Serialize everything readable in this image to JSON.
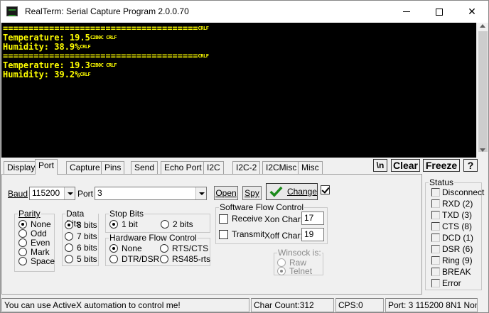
{
  "window": {
    "title": "RealTerm: Serial Capture Program 2.0.0.70",
    "close_glyph": "✕"
  },
  "terminal": {
    "lines": [
      {
        "text": "======================================",
        "ctrl": "CRLF"
      },
      {
        "text": "Temperature: 19.5",
        "ctrl": "C2B0C CRLF"
      },
      {
        "text": "Humidity: 38.9%",
        "ctrl": "CRLF"
      },
      {
        "text": "======================================",
        "ctrl": "CRLF"
      },
      {
        "text": "Temperature: 19.3",
        "ctrl": "C2B0C CRLF"
      },
      {
        "text": "Humidity: 39.2%",
        "ctrl": "CRLF"
      }
    ],
    "text_color": "#ffff00",
    "bg_color": "#000000"
  },
  "tabs": [
    {
      "label": "Display"
    },
    {
      "label": "Port"
    },
    {
      "label": "Capture"
    },
    {
      "label": "Pins"
    },
    {
      "label": "Send"
    },
    {
      "label": "Echo Port"
    },
    {
      "label": "I2C"
    },
    {
      "label": "I2C-2"
    },
    {
      "label": "I2CMisc"
    },
    {
      "label": "Misc"
    }
  ],
  "active_tab": "Port",
  "top_buttons": {
    "newline": "\\n",
    "clear": "Clear",
    "freeze": "Freeze",
    "help": "?"
  },
  "port": {
    "baud_label": "Baud",
    "baud_value": "115200",
    "port_label": "Port",
    "port_value": "3",
    "open_label": "Open",
    "spy_label": "Spy",
    "change_label": "Change",
    "change_checked": true,
    "parity": {
      "label": "Parity",
      "options": [
        "None",
        "Odd",
        "Even",
        "Mark",
        "Space"
      ],
      "selected": "None"
    },
    "data_bits": {
      "label": "Data Bits",
      "options": [
        "8 bits",
        "7 bits",
        "6 bits",
        "5 bits"
      ],
      "selected": "8 bits"
    },
    "stop_bits": {
      "label": "Stop Bits",
      "options": [
        "1 bit",
        "2 bits"
      ],
      "selected": "1 bit"
    },
    "hw_flow": {
      "label": "Hardware Flow Control",
      "options": [
        "None",
        "RTS/CTS",
        "DTR/DSR",
        "RS485-rts"
      ],
      "selected": "None"
    },
    "sw_flow": {
      "label": "Software Flow Control",
      "receive_label": "Receive",
      "transmit_label": "Transmit",
      "xon_label": "Xon Char:",
      "xon_value": "17",
      "xoff_label": "Xoff Char:",
      "xoff_value": "19"
    },
    "winsock": {
      "label": "Winsock is:",
      "options": [
        "Raw",
        "Telnet"
      ],
      "selected": "Telnet"
    }
  },
  "status": {
    "label": "Status",
    "items": [
      "Disconnect",
      "RXD (2)",
      "TXD (3)",
      "CTS (8)",
      "DCD (1)",
      "DSR (6)",
      "Ring (9)",
      "BREAK",
      "Error"
    ]
  },
  "statusbar": {
    "message": "You can use ActiveX automation to control me!",
    "char_count": "Char Count:312",
    "cps": "CPS:0",
    "port_info": "Port: 3 115200 8N1 Non"
  }
}
